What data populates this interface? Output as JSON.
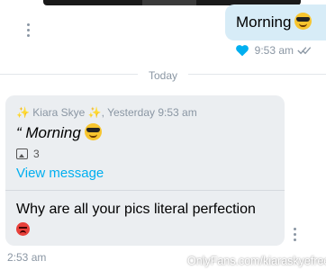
{
  "outgoing": {
    "text": "Morning",
    "emoji": "smiling-face-with-sunglasses",
    "time": "9:53 am"
  },
  "day_separator": "Today",
  "incoming": {
    "quote_sparkle_left": "✨",
    "quote_name": "Kiara Skye",
    "quote_sparkle_right": "✨",
    "quote_time": ", Yesterday 9:53 am",
    "quoted_text": "“ Morning",
    "quoted_emoji": "smiling-face-with-sunglasses",
    "media_count": "3",
    "view_link": "View message",
    "message": "Why are all your pics literal perfection",
    "message_emoji": "angry-face",
    "time": "2:53 am"
  },
  "watermark": "OnlyFans.com/kiaraskyefree",
  "colors": {
    "accent": "#00aff0",
    "outgoing_bubble": "#d7ecf7",
    "incoming_bubble": "#ebeef1",
    "meta_text": "#8a96a3"
  }
}
